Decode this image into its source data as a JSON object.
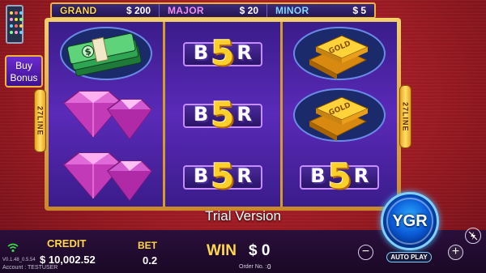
{
  "jackpots": {
    "grand": {
      "label": "GRAND",
      "value": "$ 200"
    },
    "major": {
      "label": "MAJOR",
      "value": "$ 20"
    },
    "minor": {
      "label": "MINOR",
      "value": "$ 5"
    }
  },
  "buy_bonus": {
    "line1": "Buy",
    "line2": "Bonus"
  },
  "lines_badge": "27LINE",
  "reels": [
    [
      "cash-stack-icon",
      "pink-diamond-icon",
      "pink-diamond-icon"
    ],
    [
      "B5R",
      "B5R",
      "B5R"
    ],
    [
      "gold-bars-icon",
      "gold-bars-icon",
      "B5R"
    ]
  ],
  "b5r": {
    "left": "B",
    "mid": "5",
    "right": "R"
  },
  "trial_text": "Trial Version",
  "credit": {
    "label": "CREDIT",
    "value": "$ 10,002.52"
  },
  "bet": {
    "label": "BET",
    "value": "0.2"
  },
  "win": {
    "label": "WIN",
    "value": "$ 0"
  },
  "order": {
    "label": "Order No. :",
    "value": "0"
  },
  "version": "V0.1.48_0.5.54",
  "account": "Account : TESTUSER",
  "spin_button": {
    "label": "YGR"
  },
  "autoplay_label": "AUTO PLAY",
  "controls": {
    "minus": "−",
    "plus": "+"
  },
  "colors": {
    "accent_gold": "#ffd84a",
    "spin_blue": "#0a5ad6",
    "reel_purple": "#4a24a0",
    "background_red": "#9a1a22"
  }
}
